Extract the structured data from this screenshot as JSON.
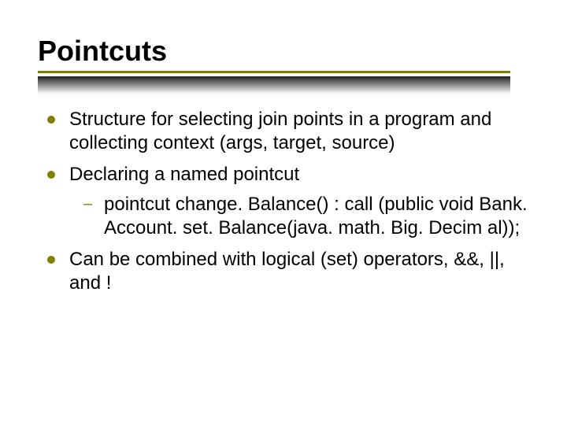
{
  "title": "Pointcuts",
  "bullets": {
    "b1": "Structure for selecting join points in a program and collecting context (args, target, source)",
    "b2": "Declaring a named pointcut",
    "b2_sub1": "pointcut change. Balance() : call (public void Bank. Account. set. Balance(java. math. Big. Decim al));",
    "b3": "Can be combined with logical (set) operators, &&, ||, and !"
  },
  "colors": {
    "accent": "#808000"
  }
}
